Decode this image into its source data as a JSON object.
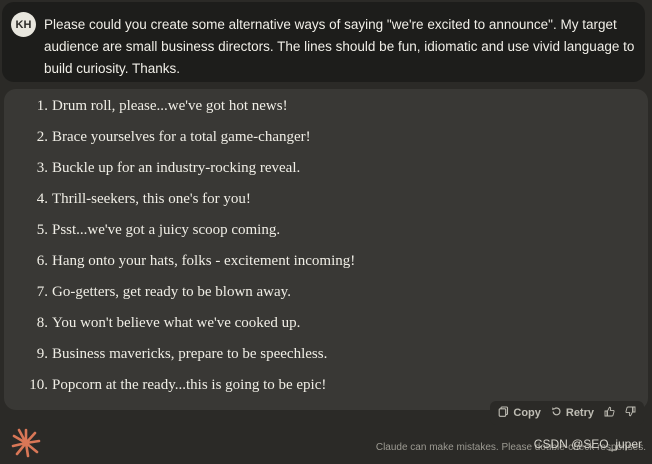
{
  "user": {
    "initials": "KH",
    "message": "Please could you create some alternative ways of saying \"we're excited to announce\". My target audience are small business directors. The lines should be fun, idiomatic and use vivid language to build curiosity. Thanks."
  },
  "response": {
    "items": [
      {
        "num": "1.",
        "text": "Drum roll, please...we've got hot news!"
      },
      {
        "num": "2.",
        "text": "Brace yourselves for a total game-changer!"
      },
      {
        "num": "3.",
        "text": "Buckle up for an industry-rocking reveal."
      },
      {
        "num": "4.",
        "text": "Thrill-seekers, this one's for you!"
      },
      {
        "num": "5.",
        "text": "Psst...we've got a juicy scoop coming."
      },
      {
        "num": "6.",
        "text": "Hang onto your hats, folks - excitement incoming!"
      },
      {
        "num": "7.",
        "text": "Go-getters, get ready to be blown away."
      },
      {
        "num": "8.",
        "text": "You won't believe what we've cooked up."
      },
      {
        "num": "9.",
        "text": "Business mavericks, prepare to be speechless."
      },
      {
        "num": "10.",
        "text": "Popcorn at the ready...this is going to be epic!"
      }
    ]
  },
  "actions": {
    "copy_label": "Copy",
    "retry_label": "Retry",
    "copy_icon": "copy-icon",
    "retry_icon": "retry-icon",
    "thumbs_up_icon": "thumbs-up-icon",
    "thumbs_down_icon": "thumbs-down-icon"
  },
  "footer": {
    "disclaimer": "Claude can make mistakes. Please double-check responses.",
    "watermark": "CSDN @SEO_juper"
  },
  "colors": {
    "background": "#2b2a27",
    "user_bubble": "#1d1d1b",
    "response_bubble": "#393835",
    "logo_accent": "#d97757"
  }
}
